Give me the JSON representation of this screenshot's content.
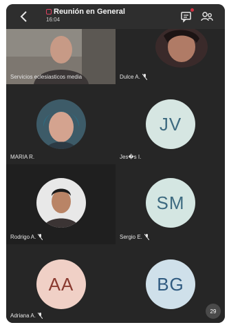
{
  "header": {
    "title": "Reunión en General",
    "timer": "16:04"
  },
  "participants": [
    {
      "label": "Servicios eclesiasticos media",
      "type": "video-large"
    },
    {
      "label": "Dulce A.",
      "type": "photo"
    },
    {
      "label": "MARIA R.",
      "type": "photo"
    },
    {
      "label": "Jes�s I.",
      "initials": "JV",
      "type": "initials",
      "color": "#d6e6e2",
      "text_color": "#3d6a80"
    },
    {
      "label": "Rodrigo A.",
      "type": "photo"
    },
    {
      "label": "Sergio E.",
      "initials": "SM",
      "type": "initials",
      "color": "#d4e6e2",
      "text_color": "#3d6a80"
    },
    {
      "label": "Adriana A.",
      "initials": "AA",
      "type": "initials",
      "color": "#f0d0c6",
      "text_color": "#8a3a30"
    },
    {
      "label": "",
      "initials": "BG",
      "type": "initials",
      "color": "#cfe0ea",
      "text_color": "#2f5a80"
    }
  ],
  "fab": {
    "label": "29"
  },
  "colors": {
    "background": "#2b2b2b",
    "record_accent": "#e04060"
  }
}
